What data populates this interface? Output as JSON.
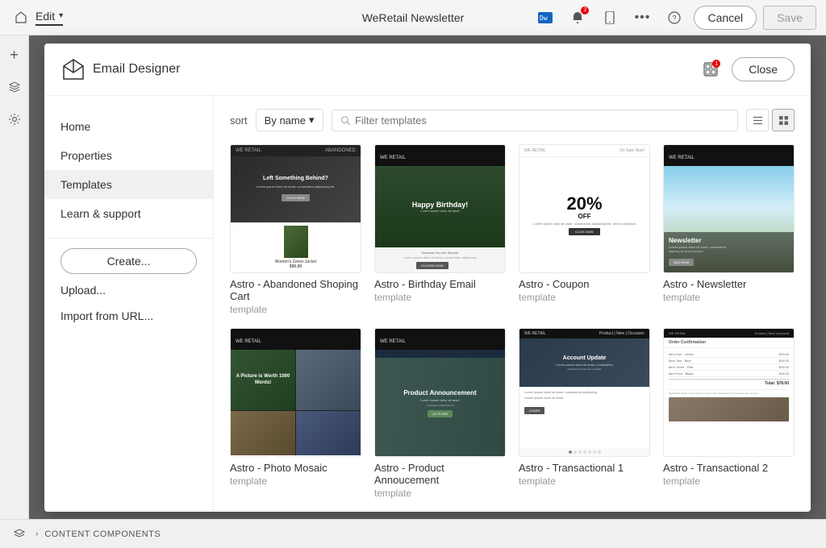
{
  "topbar": {
    "title": "WeRetail Newsletter",
    "edit_label": "Edit",
    "cancel_label": "Cancel",
    "save_label": "Save"
  },
  "modal": {
    "title": "Email Designer",
    "close_label": "Close",
    "nav": [
      {
        "id": "home",
        "label": "Home"
      },
      {
        "id": "properties",
        "label": "Properties"
      },
      {
        "id": "templates",
        "label": "Templates"
      },
      {
        "id": "learn-support",
        "label": "Learn & support"
      }
    ],
    "create_label": "Create...",
    "upload_label": "Upload...",
    "import_label": "Import from URL...",
    "sort_label": "sort",
    "sort_value": "By name",
    "search_placeholder": "Filter templates",
    "templates": [
      {
        "name": "Astro - Abandoned Shoping Cart",
        "type": "template",
        "thumb": "t1"
      },
      {
        "name": "Astro - Birthday Email",
        "type": "template",
        "thumb": "t2"
      },
      {
        "name": "Astro - Coupon",
        "type": "template",
        "thumb": "t3"
      },
      {
        "name": "Astro - Newsletter",
        "type": "template",
        "thumb": "t4"
      },
      {
        "name": "Astro - Photo Mosaic",
        "type": "template",
        "thumb": "t5"
      },
      {
        "name": "Astro - Product Annoucement",
        "type": "template",
        "thumb": "t6"
      },
      {
        "name": "Astro - Transactional 1",
        "type": "template",
        "thumb": "t7"
      },
      {
        "name": "Astro - Transactional 2",
        "type": "template",
        "thumb": "t8"
      }
    ]
  },
  "bottom_bar": {
    "label": "CONTENT COMPONENTS"
  }
}
